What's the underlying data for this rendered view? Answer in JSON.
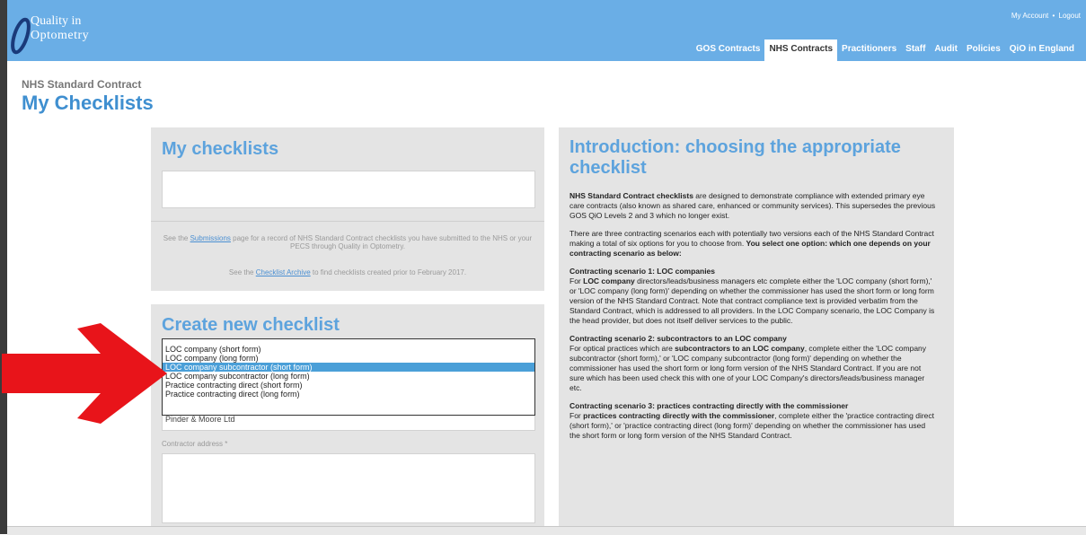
{
  "brand": {
    "line1": "Quality in",
    "line2": "Optometry"
  },
  "account": {
    "my_account": "My Account",
    "separator": "•",
    "logout": "Logout"
  },
  "nav": [
    "GOS Contracts",
    "NHS Contracts",
    "Practitioners",
    "Staff",
    "Audit",
    "Policies",
    "QiO in England"
  ],
  "nav_active": "NHS Contracts",
  "page": {
    "subtitle": "NHS Standard Contract",
    "title": "My Checklists"
  },
  "my_checklists": {
    "title": "My checklists",
    "info1_pre": "See the ",
    "info1_link": "Submissions",
    "info1_post": " page for a record of NHS Standard Contract checklists you have submitted to the NHS or your PECS through Quality in Optometry.",
    "info2_pre": "See the ",
    "info2_link": "Checklist Archive",
    "info2_post": " to find checklists created prior to February 2017."
  },
  "create": {
    "title": "Create new checklist",
    "options": [
      "LOC company (short form)",
      "LOC company (long form)",
      "LOC company subcontractor (short form)",
      "LOC company subcontractor (long form)",
      "Practice contracting direct (short form)",
      "Practice contracting direct (long form)"
    ],
    "selected_option": "LOC company subcontractor (short form)",
    "contractor_value": "Pinder & Moore Ltd",
    "address_label": "Contractor address *"
  },
  "intro": {
    "title": "Introduction: choosing the appropriate checklist",
    "p1_bold": "NHS Standard Contract checklists",
    "p1_rest": " are designed to demonstrate compliance with extended primary eye care contracts (also known as shared care, enhanced or community services). This supersedes the previous GOS QiO Levels 2 and 3 which no longer exist.",
    "p2_rest": "There are three contracting scenarios each with potentially two versions each of the NHS Standard Contract making a total of six options for you to choose from. ",
    "p2_bold": "You select one option: which one depends on your contracting scenario as below:",
    "s1_head": "Contracting scenario 1: LOC companies",
    "s1_pre": "For ",
    "s1_bold": "LOC company",
    "s1_rest": " directors/leads/business managers etc complete either the 'LOC company (short form),' or 'LOC company (long form)' depending on whether the commissioner has used the short form or long form version of the NHS Standard Contract. Note that contract compliance text is provided verbatim from the Standard Contract, which is addressed to all providers. In the LOC Company scenario, the LOC Company is the head provider, but does not itself deliver services to the public.",
    "s2_head": "Contracting scenario 2: subcontractors to an LOC company",
    "s2_pre": "For optical practices which are ",
    "s2_bold": "subcontractors to an LOC company",
    "s2_rest": ", complete either the 'LOC company subcontractor (short form),' or 'LOC company subcontractor (long form)' depending on whether the commissioner has used the short form or long form version of the NHS Standard Contract. If you are not sure which has been used check this with one of your LOC Company's directors/leads/business manager etc.",
    "s3_head": "Contracting scenario 3: practices contracting directly with the commissioner",
    "s3_pre": "For ",
    "s3_bold": "practices contracting directly with the commissioner",
    "s3_rest": ", complete either the 'practice contracting direct (short form),' or 'practice contracting direct (long form)' depending on whether the commissioner has used the short form or long form version of the NHS Standard Contract."
  },
  "colors": {
    "header": "#6aaee6",
    "accent": "#5da3dd",
    "panel": "#e4e4e4",
    "arrow": "#e8141a",
    "selected": "#4a9fd8"
  },
  "annotation": {
    "arrow_icon": "red-arrow-icon"
  }
}
